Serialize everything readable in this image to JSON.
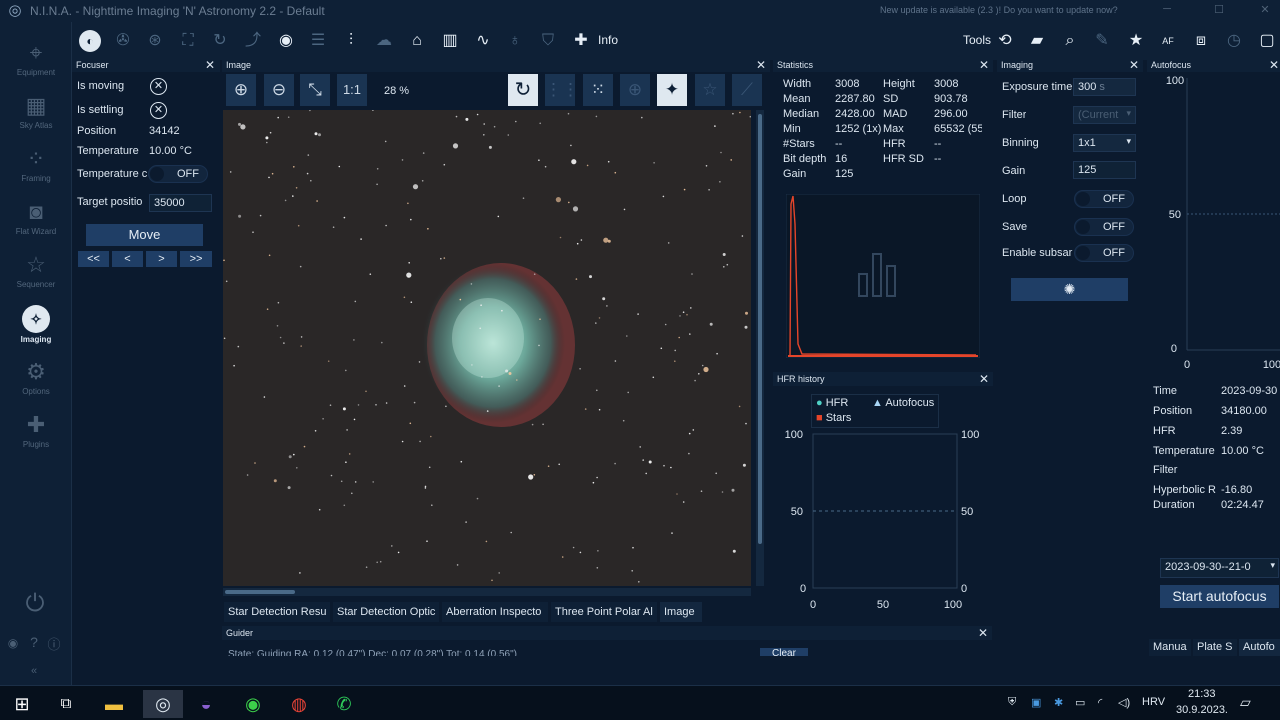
{
  "app": {
    "logo": "nina-logo-icon",
    "title": "N.I.N.A. - Nighttime Imaging 'N' Astronomy 2.2   -   Default",
    "update_notice": "New update is available (2.3 )! Do you want to update now?"
  },
  "sidebar": {
    "items": [
      {
        "label": "Equipment",
        "icon": "telescope-icon"
      },
      {
        "label": "Sky Atlas",
        "icon": "map-icon"
      },
      {
        "label": "Framing",
        "icon": "framing-icon"
      },
      {
        "label": "Flat Wizard",
        "icon": "flat-panel-icon"
      },
      {
        "label": "Sequencer",
        "icon": "stars-list-icon"
      },
      {
        "label": "Imaging",
        "icon": "imaging-icon",
        "active": true
      },
      {
        "label": "Options",
        "icon": "gears-icon"
      },
      {
        "label": "Plugins",
        "icon": "puzzle-icon"
      }
    ]
  },
  "toolbar": {
    "info_label": "Info",
    "tools_label": "Tools"
  },
  "focuser": {
    "title": "Focuser",
    "is_moving_label": "Is moving",
    "is_settling_label": "Is settling",
    "position_label": "Position",
    "position_value": "34142",
    "temperature_label": "Temperature",
    "temperature_value": "10.00 °C",
    "temp_comp_label": "Temperature c",
    "temp_comp_value": "OFF",
    "target_label": "Target positio",
    "target_value": "35000",
    "move_label": "Move",
    "nav": [
      "<<",
      "<",
      ">",
      ">>"
    ]
  },
  "image": {
    "title": "Image",
    "zoom_value": "28 %",
    "one_to_one": "1:1",
    "tabs": [
      "Star Detection Resu",
      "Star Detection Optic",
      "Aberration Inspecto",
      "Three Point Polar Al",
      "Image"
    ]
  },
  "statistics": {
    "title": "Statistics",
    "rows": [
      [
        "Width",
        "3008",
        "Height",
        "3008"
      ],
      [
        "Mean",
        "2287.80",
        "SD",
        "903.78"
      ],
      [
        "Median",
        "2428.00",
        "MAD",
        "296.00"
      ],
      [
        "Min",
        "1252 (1x)",
        "Max",
        "65532 (55"
      ],
      [
        "#Stars",
        "--",
        "HFR",
        "--"
      ],
      [
        "Bit depth",
        "16",
        "HFR SD",
        "--"
      ],
      [
        "Gain",
        "125",
        "",
        ""
      ]
    ]
  },
  "hfr_history": {
    "title": "HFR history",
    "legend": [
      {
        "name": "HFR",
        "color": "#4fd1c5"
      },
      {
        "name": "Autofocus",
        "color": "#a9d6f5"
      },
      {
        "name": "Stars",
        "color": "#e5452a"
      }
    ],
    "yticks": [
      "100",
      "50",
      "0"
    ],
    "xticks": [
      "0",
      "50",
      "100"
    ]
  },
  "imaging_panel": {
    "title": "Imaging",
    "exposure_label": "Exposure time",
    "exposure_value": "300",
    "exposure_unit": "s",
    "filter_label": "Filter",
    "filter_value": "(Current",
    "binning_label": "Binning",
    "binning_value": "1x1",
    "gain_label": "Gain",
    "gain_value": "125",
    "loop_label": "Loop",
    "loop_value": "OFF",
    "save_label": "Save",
    "save_value": "OFF",
    "subsample_label": "Enable subsar",
    "subsample_value": "OFF"
  },
  "autofocus": {
    "title": "Autofocus",
    "yticks": [
      "100",
      "50",
      "0"
    ],
    "xticks": [
      "0",
      "100"
    ],
    "rows": [
      [
        "Time",
        "2023-09-30"
      ],
      [
        "Position",
        "34180.00"
      ],
      [
        "HFR",
        "2.39"
      ],
      [
        "Temperature",
        "10.00 °C"
      ],
      [
        "Filter",
        ""
      ],
      [
        "Hyperbolic R",
        "-16.80"
      ],
      [
        "Duration",
        "02:24.47"
      ]
    ],
    "run_value": "2023-09-30--21-0",
    "start_label": "Start autofocus",
    "tabs": [
      "Manua",
      "Plate S",
      "Autofo"
    ]
  },
  "guider": {
    "title": "Guider",
    "status": "State: Guiding   RA: 0.12 (0.47\")  Dec: 0.07 (0.28\")  Tot: 0.14 (0.56\")",
    "clear_label": "Clear"
  },
  "taskbar": {
    "lang": "HRV",
    "time": "21:33",
    "date": "30.9.2023."
  }
}
